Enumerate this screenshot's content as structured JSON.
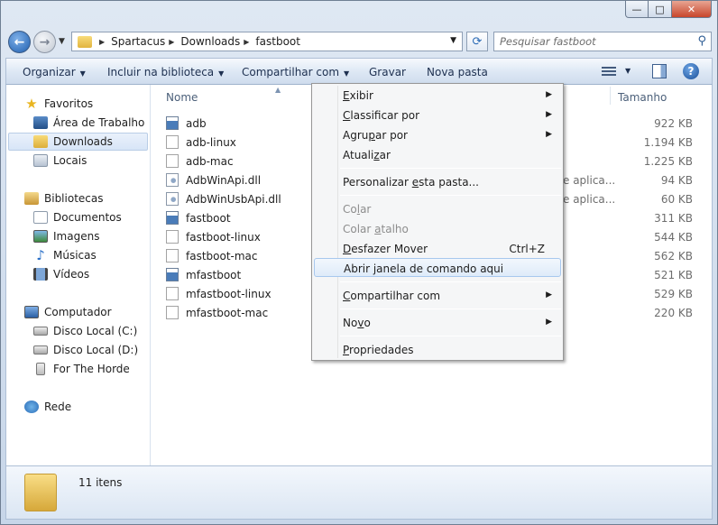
{
  "window": {
    "minimize_glyph": "—",
    "maximize_glyph": "□",
    "close_glyph": "✕"
  },
  "address": {
    "crumbs": [
      "Spartacus",
      "Downloads",
      "fastboot"
    ]
  },
  "search": {
    "placeholder": "Pesquisar fastboot"
  },
  "toolbar": {
    "organize": "Organizar",
    "include_library": "Incluir na biblioteca",
    "share_with": "Compartilhar com",
    "burn": "Gravar",
    "new_folder": "Nova pasta",
    "help": "?"
  },
  "navpane": {
    "favorites": "Favoritos",
    "desktop": "Área de Trabalho",
    "downloads": "Downloads",
    "places": "Locais",
    "libraries": "Bibliotecas",
    "documents": "Documentos",
    "images": "Imagens",
    "music": "Músicas",
    "videos": "Vídeos",
    "computer": "Computador",
    "disk_c": "Disco Local (C:)",
    "disk_d": "Disco Local (D:)",
    "usb": "For The Horde",
    "network": "Rede"
  },
  "columns": {
    "name": "Nome",
    "size": "Tamanho"
  },
  "files": [
    {
      "name": "adb",
      "type": "",
      "size": "922 KB",
      "icon": "exe"
    },
    {
      "name": "adb-linux",
      "type": "",
      "size": "1.194 KB",
      "icon": "file"
    },
    {
      "name": "adb-mac",
      "type": "",
      "size": "1.225 KB",
      "icon": "file"
    },
    {
      "name": "AdbWinApi.dll",
      "type": "e aplica...",
      "size": "94 KB",
      "icon": "dll"
    },
    {
      "name": "AdbWinUsbApi.dll",
      "type": "e aplica...",
      "size": "60 KB",
      "icon": "dll"
    },
    {
      "name": "fastboot",
      "type": "",
      "size": "311 KB",
      "icon": "exe"
    },
    {
      "name": "fastboot-linux",
      "type": "",
      "size": "544 KB",
      "icon": "file"
    },
    {
      "name": "fastboot-mac",
      "type": "",
      "size": "562 KB",
      "icon": "file"
    },
    {
      "name": "mfastboot",
      "type": "",
      "size": "521 KB",
      "icon": "exe"
    },
    {
      "name": "mfastboot-linux",
      "type": "",
      "size": "529 KB",
      "icon": "file"
    },
    {
      "name": "mfastboot-mac",
      "type": "",
      "size": "220 KB",
      "icon": "file"
    }
  ],
  "status": {
    "count": "11 itens"
  },
  "context_menu": {
    "view": {
      "pre": "",
      "key": "E",
      "post": "xibir"
    },
    "sort_by": {
      "pre": "",
      "key": "C",
      "post": "lassificar por"
    },
    "group_by": {
      "pre": "Agru",
      "key": "p",
      "post": "ar por"
    },
    "refresh": {
      "pre": "Atuali",
      "key": "z",
      "post": "ar"
    },
    "customize": {
      "pre": "Personalizar ",
      "key": "e",
      "post": "sta pasta..."
    },
    "paste": {
      "pre": "Co",
      "key": "l",
      "post": "ar"
    },
    "paste_shortcut": {
      "pre": "Colar ",
      "key": "a",
      "post": "talho"
    },
    "undo_move": {
      "pre": "",
      "key": "D",
      "post": "esfazer Mover",
      "shortcut": "Ctrl+Z"
    },
    "open_cmd": {
      "pre": "Abrir janela de comando aqui",
      "key": "",
      "post": ""
    },
    "share": {
      "pre": "",
      "key": "C",
      "post": "ompartilhar com"
    },
    "new": {
      "pre": "No",
      "key": "v",
      "post": "o"
    },
    "properties": {
      "pre": "",
      "key": "P",
      "post": "ropriedades"
    }
  }
}
